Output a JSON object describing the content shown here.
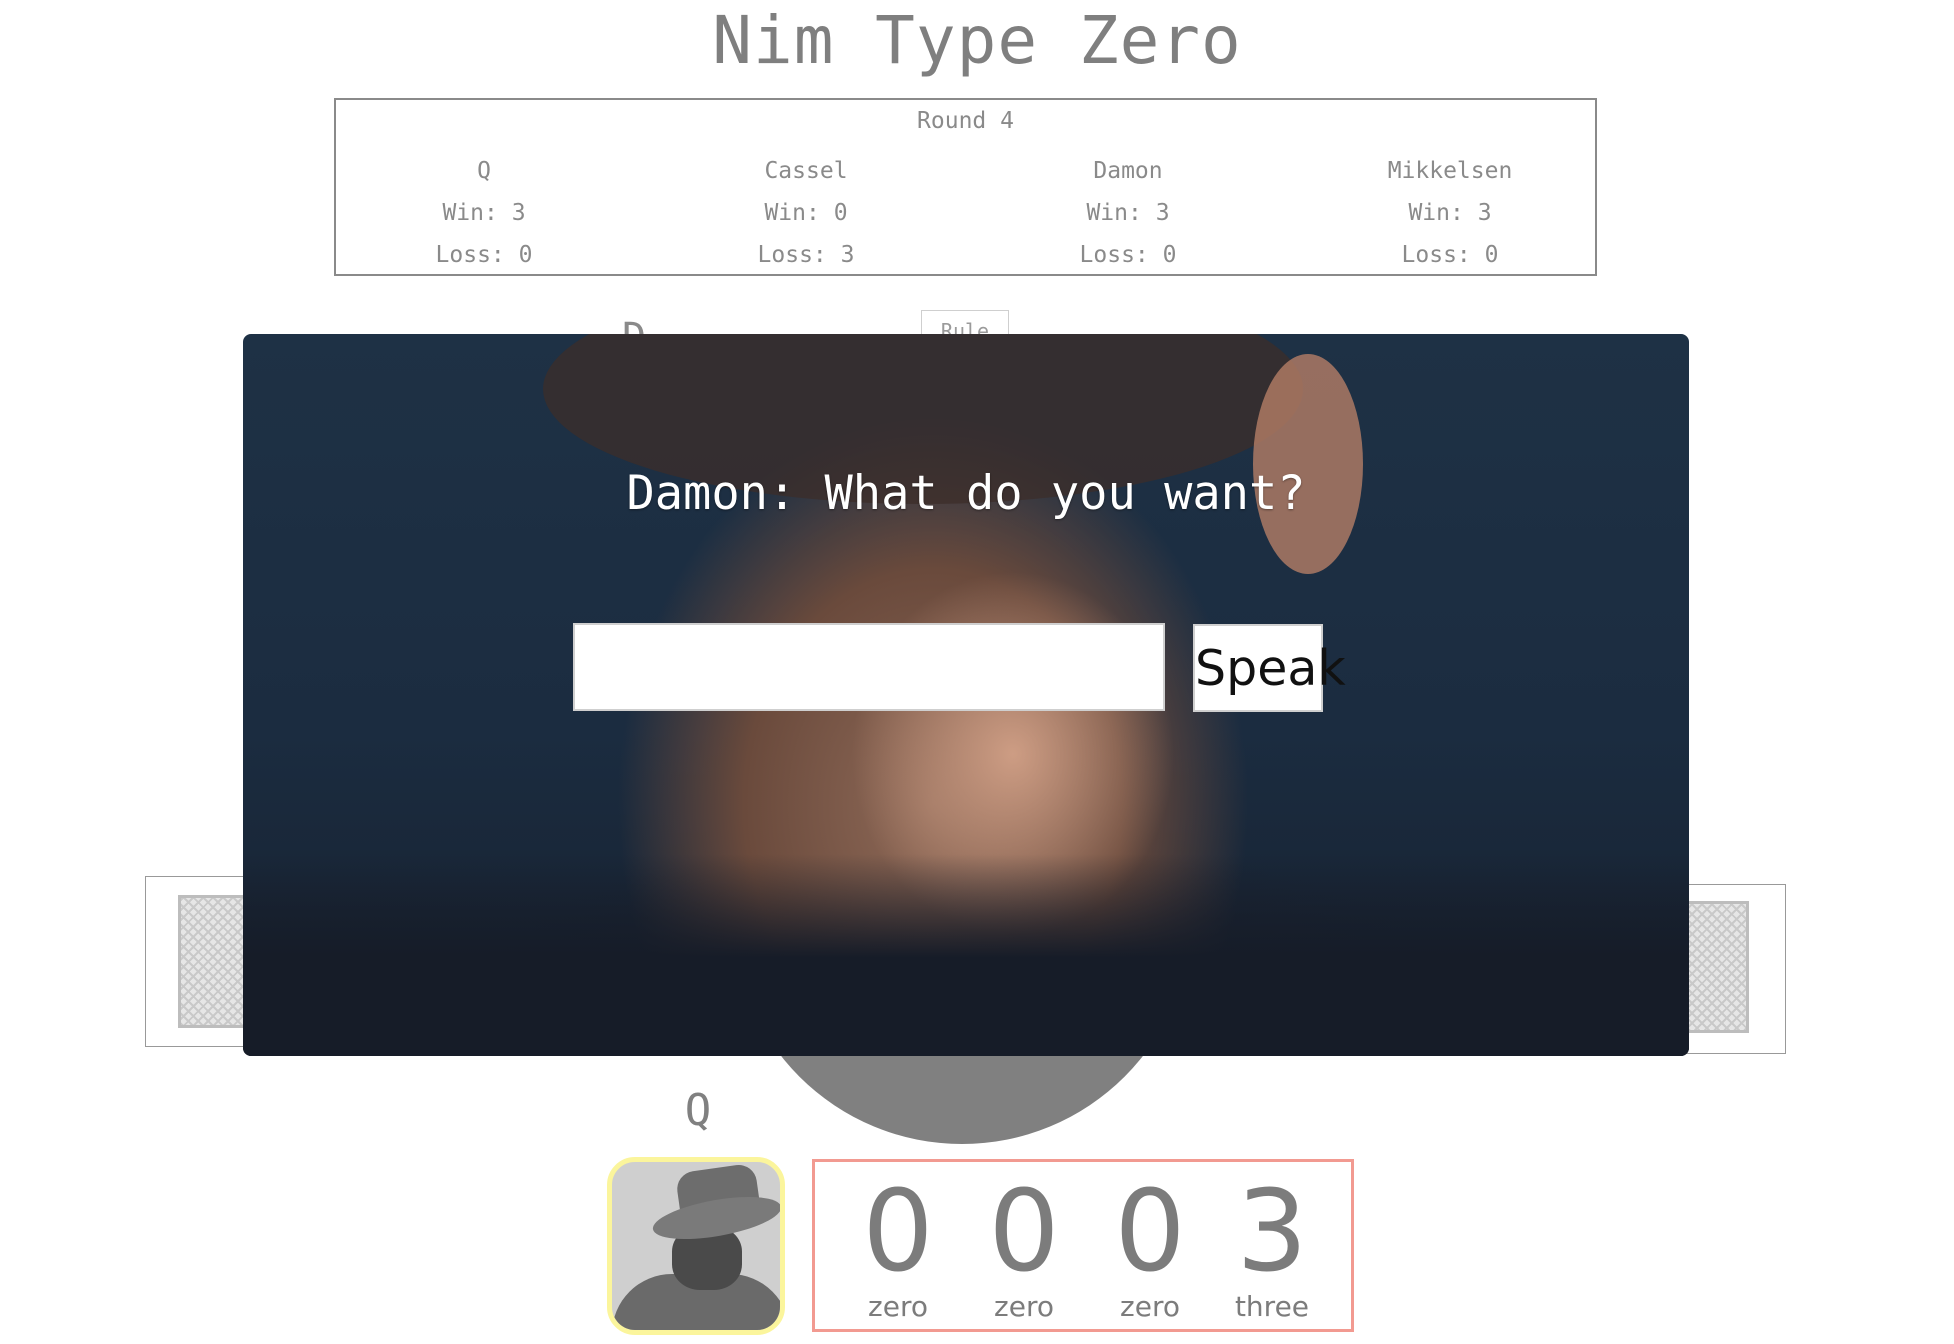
{
  "game_title": "Nim Type Zero",
  "scoreboard": {
    "round_label": "Round 4",
    "players": [
      {
        "name": "Q",
        "win": "Win: 3",
        "loss": "Loss: 0"
      },
      {
        "name": "Cassel",
        "win": "Win: 0",
        "loss": "Loss: 3"
      },
      {
        "name": "Damon",
        "win": "Win: 3",
        "loss": "Loss: 0"
      },
      {
        "name": "Mikkelsen",
        "win": "Win: 3",
        "loss": "Loss: 0"
      }
    ]
  },
  "background": {
    "partial_letter": "D",
    "rule_button_label": "Rule"
  },
  "dialog": {
    "question": "Damon: What do you want?",
    "input_value": "",
    "input_placeholder": "",
    "speak_label": "Speak"
  },
  "current_player": {
    "name": "Q",
    "avatar_icon": "player-avatar-fedora"
  },
  "counter": {
    "digits": [
      {
        "digit": "0",
        "word": "zero"
      },
      {
        "digit": "0",
        "word": "zero"
      },
      {
        "digit": "0",
        "word": "zero"
      },
      {
        "digit": "3",
        "word": "three"
      }
    ]
  },
  "colors": {
    "avatar_border": "#fbf59c",
    "counter_border": "#f29a91",
    "text_gray": "#808080"
  }
}
